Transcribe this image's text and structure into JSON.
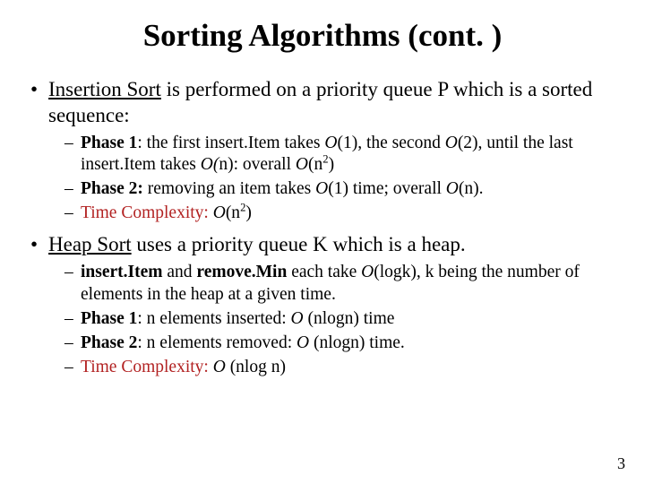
{
  "title": "Sorting Algorithms (cont. )",
  "bullet1": {
    "lead_u": "Insertion Sort",
    "lead_rest": " is performed on a priority queue P which is a sorted sequence:",
    "sub1": {
      "label": "Phase 1",
      "t1": ": the first insert.Item takes ",
      "o1": "O",
      "t2": "(1), the second ",
      "o2": "O",
      "t3": "(2), until the last insert.Item takes ",
      "o3": "O(",
      "t4": "n): overall ",
      "o4": "O",
      "t5": "(n",
      "sup": "2",
      "t6": ")"
    },
    "sub2": {
      "label": "Phase 2:",
      "t1": " removing an item takes ",
      "o1": "O",
      "t2": "(1) time; overall ",
      "o2": "O",
      "t3": "(n)."
    },
    "sub3": {
      "label": "Time Complexity:",
      "sp": " ",
      "o": "O",
      "t1": "(n",
      "sup": "2",
      "t2": ")"
    }
  },
  "bullet2": {
    "lead_u": "Heap Sort",
    "lead_rest": " uses a priority queue K which is a heap.",
    "sub1": {
      "b1": "insert.Item",
      "t1": " and ",
      "b2": "remove.Min",
      "t2": " each take ",
      "o": "O",
      "t3": "(logk), k being the number of elements in the heap at a given time."
    },
    "sub2": {
      "label": "Phase 1",
      "t1": ": n elements inserted: ",
      "o": "O",
      "t2": " (nlogn) time"
    },
    "sub3": {
      "label": "Phase 2",
      "t1": ": n elements removed: ",
      "o": "O",
      "t2": " (nlogn) time."
    },
    "sub4": {
      "label": "Time Complexity:",
      "sp": " ",
      "o": "O",
      "t1": " (nlog n)"
    }
  },
  "pagenum": "3"
}
